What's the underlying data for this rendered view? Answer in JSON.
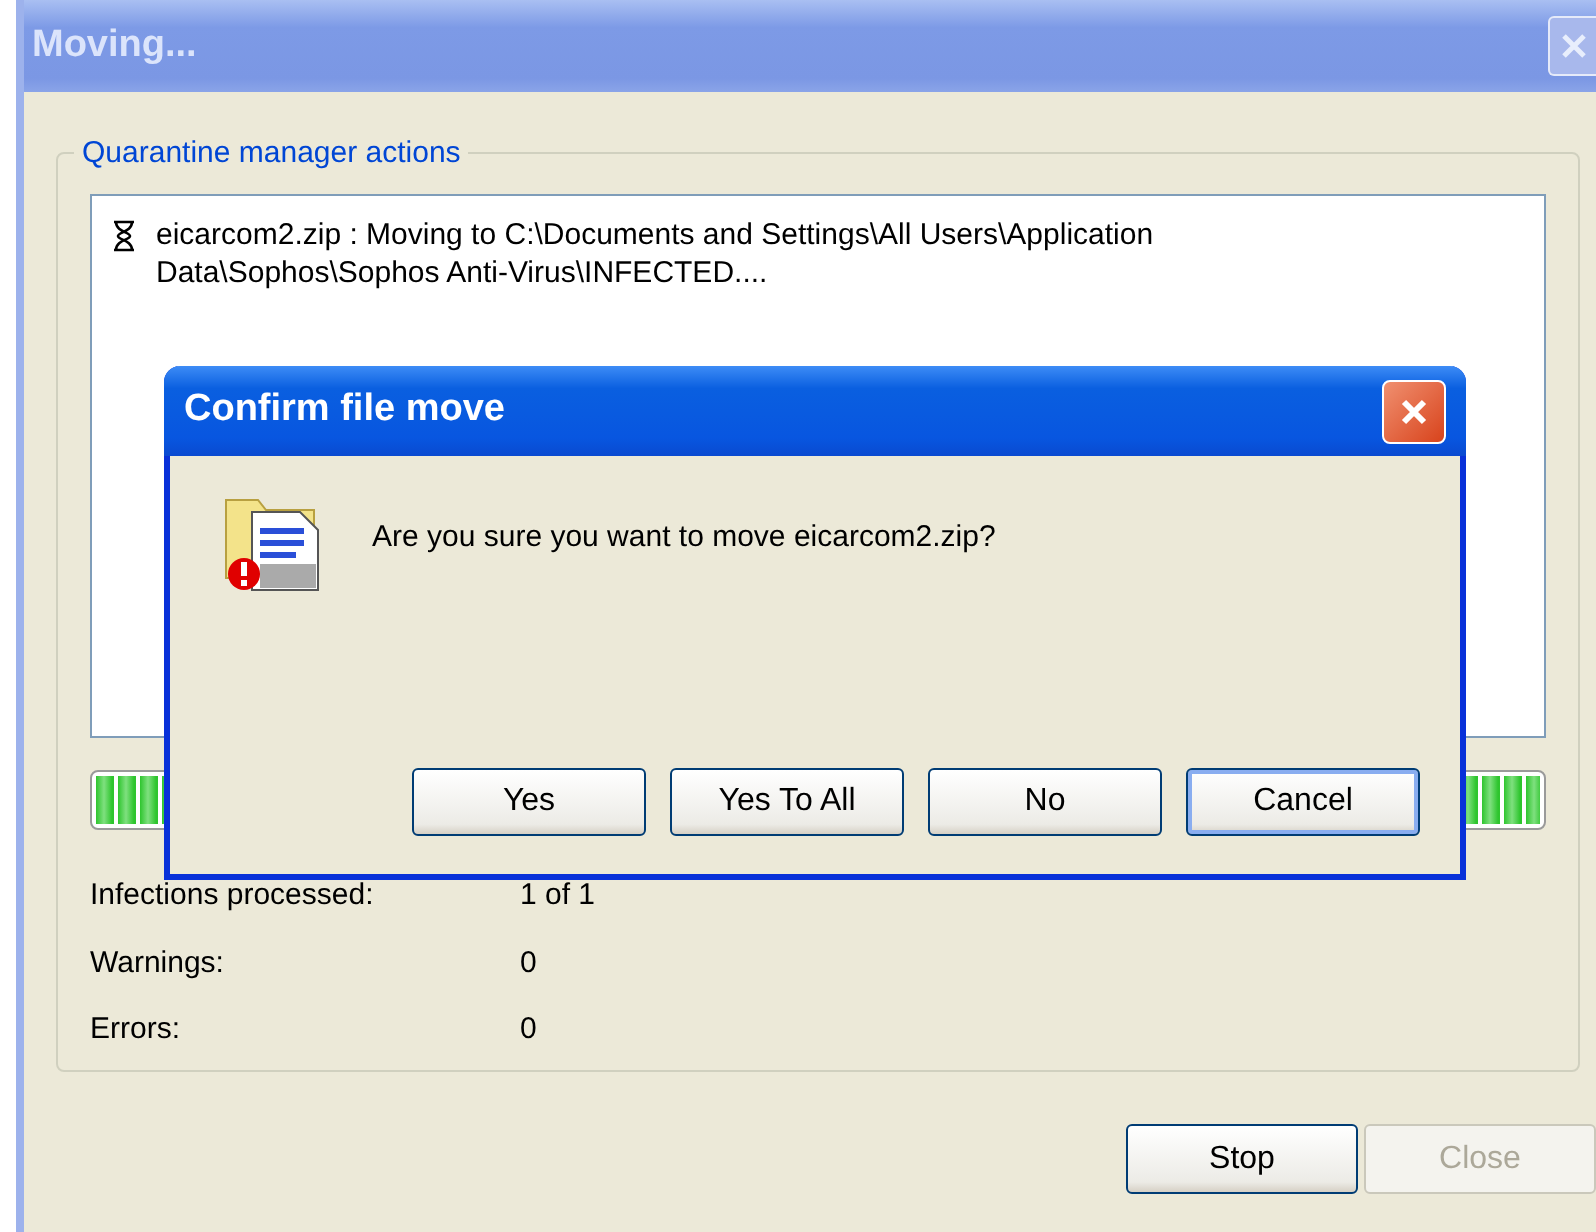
{
  "window": {
    "title": "Moving...",
    "active": false
  },
  "group": {
    "title": "Quarantine manager actions"
  },
  "log": [
    {
      "text": "eicarcom2.zip : Moving to C:\\Documents and Settings\\All Users\\Application Data\\Sophos\\Sophos Anti-Virus\\INFECTED...."
    }
  ],
  "progress": {
    "level": 1
  },
  "stats": [
    {
      "label": "Infections processed:",
      "value": "1 of 1"
    },
    {
      "label": "Warnings:",
      "value": "0"
    },
    {
      "label": "Errors:",
      "value": "0"
    }
  ],
  "buttons": [
    {
      "label": "Stop",
      "disabled": false
    },
    {
      "label": "Close",
      "disabled": true
    }
  ],
  "dialog": {
    "title": "Confirm file move",
    "message": "Are you sure you want to move eicarcom2.zip?",
    "buttons": [
      {
        "label": "Yes",
        "default": false
      },
      {
        "label": "Yes To All",
        "default": false
      },
      {
        "label": "No",
        "default": false
      },
      {
        "label": "Cancel",
        "default": true
      }
    ]
  }
}
